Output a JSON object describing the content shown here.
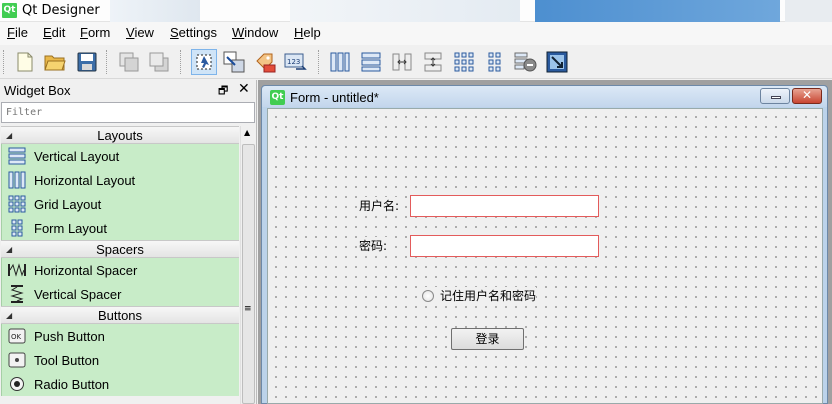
{
  "app": {
    "title": "Qt Designer",
    "logo_text": "Qt"
  },
  "menubar": {
    "items": [
      {
        "label": "File",
        "mnemonic": "F",
        "rest": "ile"
      },
      {
        "label": "Edit",
        "mnemonic": "E",
        "rest": "dit"
      },
      {
        "label": "Form",
        "mnemonic": "F",
        "rest": "orm"
      },
      {
        "label": "View",
        "mnemonic": "V",
        "rest": "iew"
      },
      {
        "label": "Settings",
        "mnemonic": "S",
        "rest": "ettings"
      },
      {
        "label": "Window",
        "mnemonic": "W",
        "rest": "indow"
      },
      {
        "label": "Help",
        "mnemonic": "H",
        "rest": "elp"
      }
    ]
  },
  "toolbar": {
    "buttons": [
      "new-file-icon",
      "open-folder-icon",
      "save-icon",
      "send-to-back-icon",
      "bring-to-front-icon",
      "edit-widgets-icon",
      "edit-signals-slots-icon",
      "edit-buddies-icon",
      "edit-tab-order-icon",
      "lay-out-horizontally-icon",
      "lay-out-vertically-icon",
      "horizontal-splitter-icon",
      "vertical-splitter-icon",
      "grid-layout-icon",
      "form-layout-icon",
      "break-layout-icon",
      "adjust-size-icon"
    ],
    "active": "edit-widgets-icon"
  },
  "widget_box": {
    "title": "Widget Box",
    "float_glyph": "🗗",
    "close_glyph": "✕",
    "filter_placeholder": "Filter",
    "categories": [
      {
        "label": "Layouts",
        "items": [
          "Vertical Layout",
          "Horizontal Layout",
          "Grid Layout",
          "Form Layout"
        ]
      },
      {
        "label": "Spacers",
        "items": [
          "Horizontal Spacer",
          "Vertical Spacer"
        ]
      },
      {
        "label": "Buttons",
        "items": [
          "Push Button",
          "Tool Button",
          "Radio Button"
        ]
      }
    ],
    "scroll_up_glyph": "▲",
    "grip_glyph": "≡"
  },
  "form_window": {
    "title": "Form - untitled*",
    "logo_text": "Qt",
    "close_glyph": "✕",
    "username_label": "用户名:",
    "password_label": "密码:",
    "remember_label": "记住用户名和密码",
    "login_button": "登录"
  },
  "colors": {
    "widget_item_bg": "#c8ecc8",
    "input_border": "#e35b5b",
    "mdi_frame": "#bcd3ea"
  }
}
